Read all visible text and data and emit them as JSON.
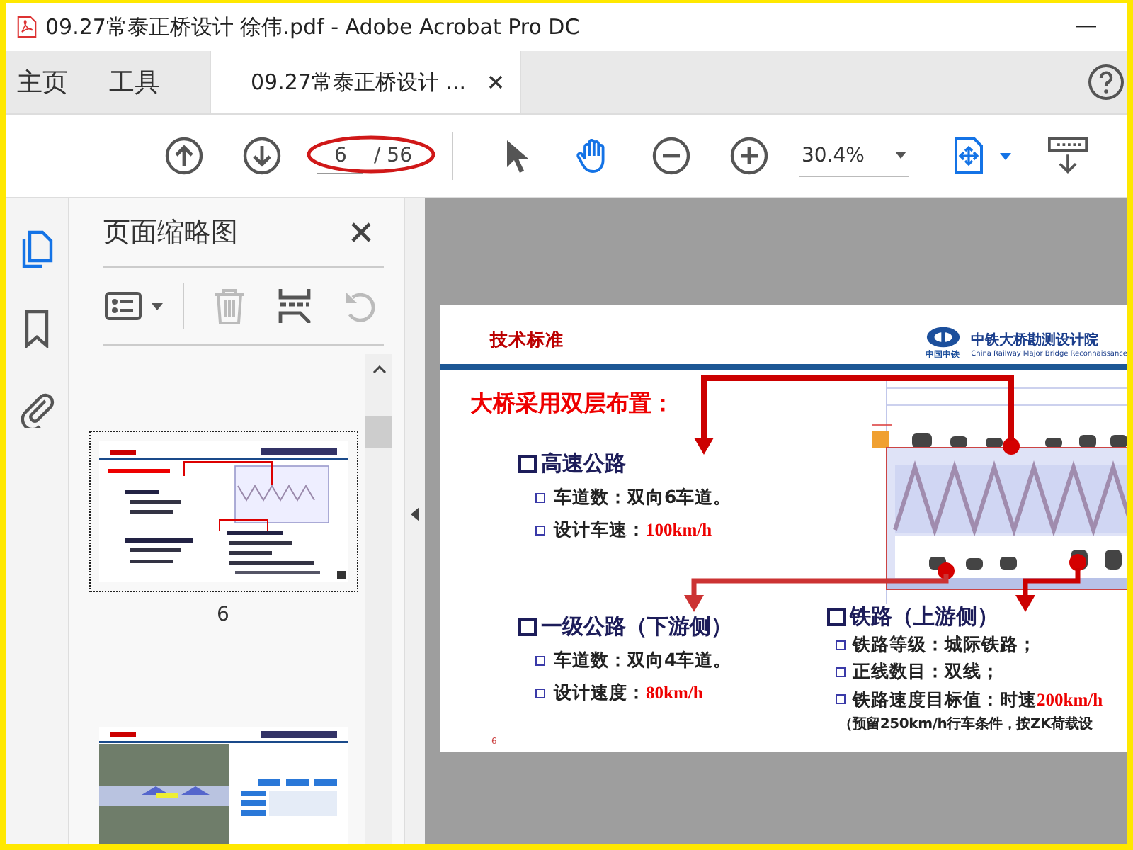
{
  "window": {
    "title": "09.27常泰正桥设计  徐伟.pdf - Adobe Acrobat Pro DC"
  },
  "top_tabs": [
    {
      "label": "主页",
      "selected": false,
      "kind": "plain"
    },
    {
      "label": "工具",
      "selected": false,
      "kind": "plain"
    },
    {
      "label": "09.27常泰正桥设计 ...",
      "selected": true,
      "kind": "document"
    }
  ],
  "toolbar": {
    "page_current": "6",
    "page_total": "/ 56",
    "zoom": "30.4%",
    "tools": [
      {
        "kind": "select",
        "selected": false
      },
      {
        "kind": "hand",
        "selected": true
      }
    ]
  },
  "rail": [
    {
      "kind": "pages",
      "selected": true
    },
    {
      "kind": "bookmarks",
      "selected": false
    },
    {
      "kind": "attachments",
      "selected": false
    }
  ],
  "thumbnail_panel": {
    "title": "页面缩略图",
    "tools": [
      {
        "kind": "options",
        "disabled": false
      },
      {
        "kind": "delete",
        "disabled": true
      },
      {
        "kind": "insert",
        "disabled": false
      },
      {
        "kind": "rotate",
        "disabled": true
      }
    ],
    "thumbnails": [
      {
        "kind": "text-slide",
        "label": "6",
        "selected": true
      },
      {
        "kind": "map-slide",
        "selected": false
      }
    ]
  },
  "slide": {
    "header": "技术标准",
    "logo_caption": "中国中铁",
    "org_name": "中铁大桥勘测设计院",
    "org_subtitle": "China Railway Major Bridge Reconnaissance",
    "headline": "大桥采用双层布置：",
    "page_number": "6",
    "sections": [
      {
        "heading": "高速公路",
        "items": [
          {
            "label": "车道数：",
            "value": "双向6车道。",
            "highlight": false
          },
          {
            "label": "设计车速：",
            "value": "100km/h",
            "highlight": true
          }
        ]
      },
      {
        "heading": "一级公路（下游侧）",
        "items": [
          {
            "label": "车道数：",
            "value": "双向4车道。",
            "highlight": false
          },
          {
            "label": "设计速度：",
            "value": "80km/h",
            "highlight": true
          }
        ]
      },
      {
        "heading": "铁路（上游侧）",
        "items": [
          {
            "label": "铁路等级：",
            "value": "城际铁路；",
            "highlight": false
          },
          {
            "label": "正线数目：",
            "value": "双线；",
            "highlight": false
          },
          {
            "label": "铁路速度目标值：时速",
            "value": "200km/h",
            "highlight": true
          }
        ],
        "note": "（预留250km/h行车条件，按ZK荷载设"
      }
    ]
  }
}
